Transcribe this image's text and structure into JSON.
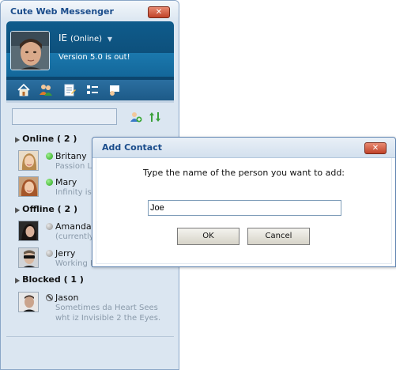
{
  "messenger": {
    "title": "Cute Web Messenger",
    "close_label": "✕",
    "profile": {
      "name": "IE",
      "status": "(Online)",
      "status_chevron": "▼",
      "message": "Version 5.0 is out!"
    },
    "toolbar_icons": [
      "home-icon",
      "contacts-icon",
      "notepad-icon",
      "list-view-icon",
      "chat-icon"
    ],
    "search": {
      "value": "",
      "placeholder": ""
    },
    "groups": [
      {
        "label": "Online ( 2 )",
        "contacts": [
          {
            "name": "Britany",
            "status_text": "Passion L",
            "status": "online"
          },
          {
            "name": "Mary",
            "status_text": "Infinity is f",
            "status": "online"
          }
        ]
      },
      {
        "label": "Offline ( 2 )",
        "contacts": [
          {
            "name": "Amanda",
            "status_text": "(currently",
            "status": "offline"
          },
          {
            "name": "Jerry",
            "status_text": "Working H",
            "status": "offline"
          }
        ]
      },
      {
        "label": "Blocked ( 1 )",
        "contacts": [
          {
            "name": "Jason",
            "status_text": "Sometimes da Heart Sees",
            "status_text_2": "wht iz Invisible 2 the Eyes.",
            "status": "blocked"
          }
        ]
      }
    ]
  },
  "dialog": {
    "title": "Add Contact",
    "close_label": "✕",
    "prompt": "Type the name of the person you want to add:",
    "input_value": "Joe",
    "ok_label": "OK",
    "cancel_label": "Cancel"
  },
  "colors": {
    "title_text": "#1a4c8b",
    "profile_bg": "#0f5c8c",
    "online": "#26a21a",
    "offline": "#8d8d8d",
    "close_button": "#c0432a"
  }
}
